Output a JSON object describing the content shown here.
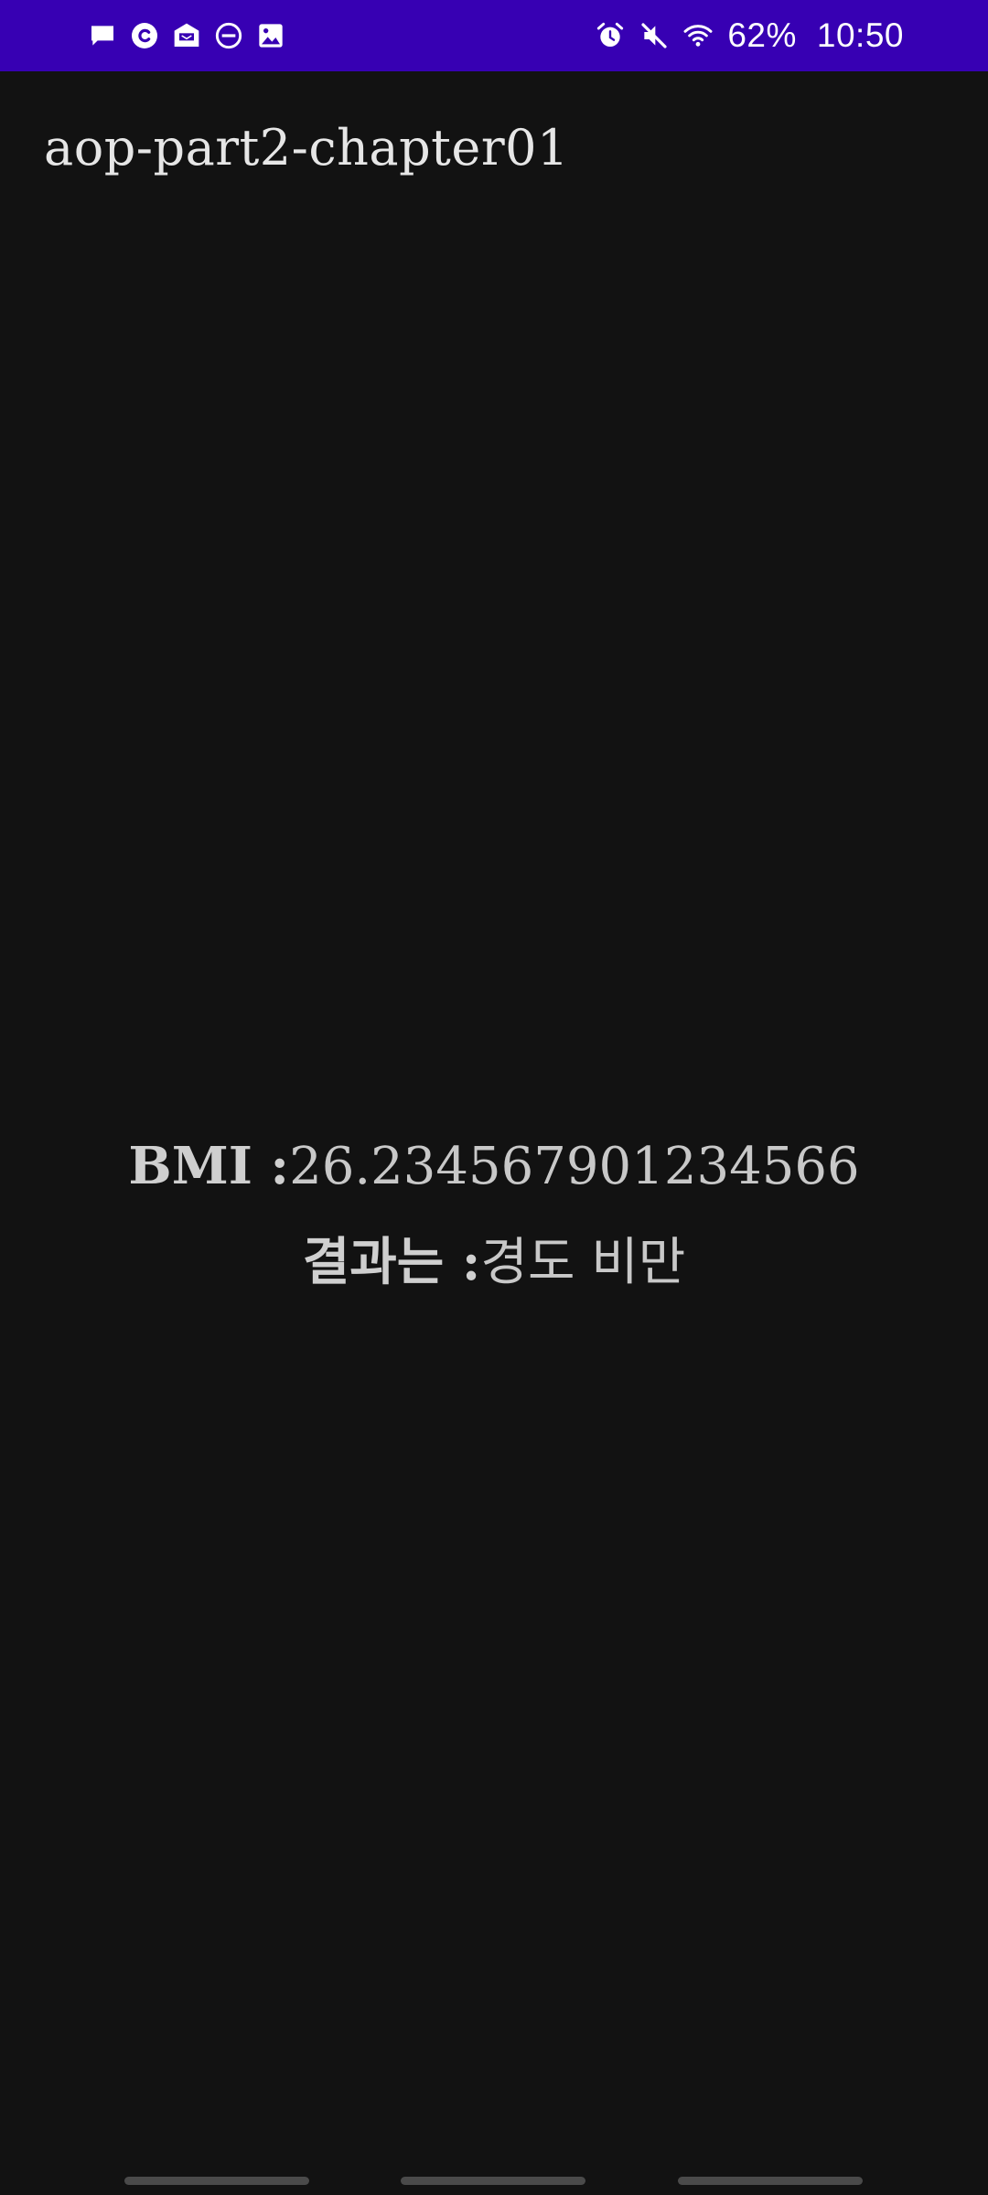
{
  "status_bar": {
    "left_icons": [
      "message-icon",
      "c-badge-icon",
      "mail-icon",
      "do-not-disturb-icon",
      "image-icon"
    ],
    "right_icons": [
      "alarm-icon",
      "mute-icon",
      "wifi-icon"
    ],
    "battery": "62%",
    "time": "10:50",
    "background_color": "#3700b3"
  },
  "app_bar": {
    "title": "aop-part2-chapter01"
  },
  "result": {
    "bmi_label": "BMI :",
    "bmi_value": "26.234567901234566",
    "result_label": "결과는 :",
    "result_value": "경도 비만"
  },
  "colors": {
    "background": "#121212",
    "text": "#c8c8c8"
  }
}
